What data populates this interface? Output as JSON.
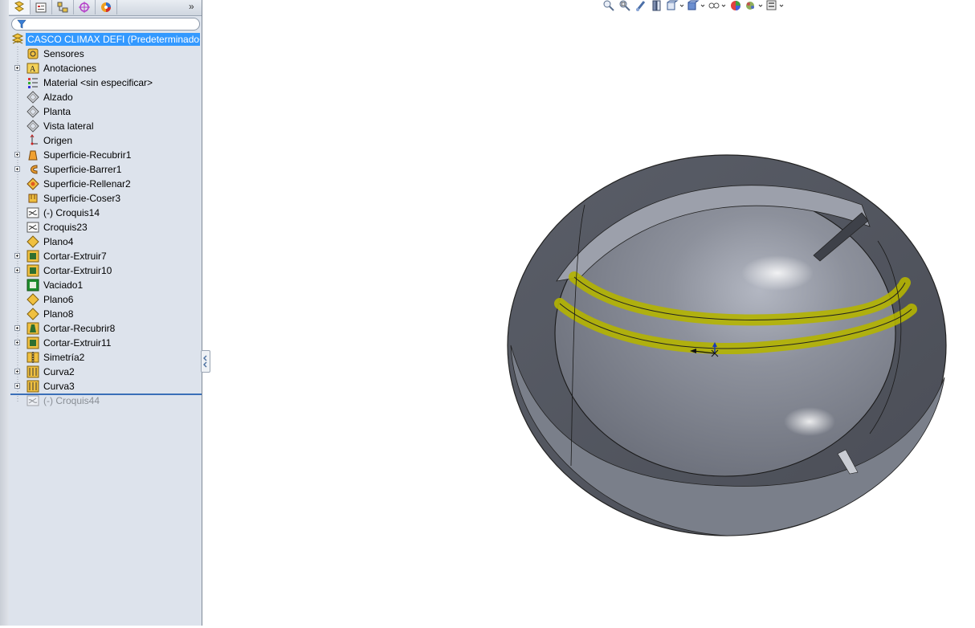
{
  "feature_tree": {
    "root_label": "CASCO CLIMAX DEFI  (Predeterminado<",
    "items": [
      {
        "label": "Sensores",
        "icon": "sensors-icon",
        "expandable": false
      },
      {
        "label": "Anotaciones",
        "icon": "annotations-icon",
        "expandable": true
      },
      {
        "label": "Material <sin especificar>",
        "icon": "material-icon",
        "expandable": false
      },
      {
        "label": "Alzado",
        "icon": "plane-icon",
        "expandable": false
      },
      {
        "label": "Planta",
        "icon": "plane-icon",
        "expandable": false
      },
      {
        "label": "Vista lateral",
        "icon": "plane-icon",
        "expandable": false
      },
      {
        "label": "Origen",
        "icon": "origin-icon",
        "expandable": false
      },
      {
        "label": "Superficie-Recubrir1",
        "icon": "surface-loft-icon",
        "expandable": true
      },
      {
        "label": "Superficie-Barrer1",
        "icon": "surface-sweep-icon",
        "expandable": true
      },
      {
        "label": "Superficie-Rellenar2",
        "icon": "surface-fill-icon",
        "expandable": false
      },
      {
        "label": "Superficie-Coser3",
        "icon": "surface-knit-icon",
        "expandable": false
      },
      {
        "label": "(-) Croquis14",
        "icon": "sketch-icon",
        "expandable": false
      },
      {
        "label": "Croquis23",
        "icon": "sketch-icon",
        "expandable": false
      },
      {
        "label": "Plano4",
        "icon": "ref-plane-icon",
        "expandable": false
      },
      {
        "label": "Cortar-Extruir7",
        "icon": "cut-extrude-icon",
        "expandable": true
      },
      {
        "label": "Cortar-Extruir10",
        "icon": "cut-extrude-icon",
        "expandable": true
      },
      {
        "label": "Vaciado1",
        "icon": "shell-icon",
        "expandable": false
      },
      {
        "label": "Plano6",
        "icon": "ref-plane-icon",
        "expandable": false
      },
      {
        "label": "Plano8",
        "icon": "ref-plane-icon",
        "expandable": false
      },
      {
        "label": "Cortar-Recubrir8",
        "icon": "cut-loft-icon",
        "expandable": true
      },
      {
        "label": "Cortar-Extruir11",
        "icon": "cut-extrude-icon",
        "expandable": true
      },
      {
        "label": "Simetría2",
        "icon": "mirror-icon",
        "expandable": false
      },
      {
        "label": "Curva2",
        "icon": "curve-icon",
        "expandable": true
      },
      {
        "label": "Curva3",
        "icon": "curve-icon",
        "expandable": true
      },
      {
        "label": "(-) Croquis44",
        "icon": "sketch-icon",
        "expandable": false,
        "suppressed": true
      }
    ]
  },
  "panel_tabs": [
    "feature-manager-icon",
    "property-manager-icon",
    "configuration-manager-icon",
    "dimxpert-icon",
    "display-manager-icon"
  ],
  "hud_toolbar": [
    "zoom-to-fit-icon",
    "zoom-to-area-icon",
    "previous-view-icon",
    "section-view-icon",
    "view-orientation-icon",
    "display-style-icon",
    "hide-show-items-icon",
    "edit-appearance-icon",
    "apply-scene-icon",
    "view-settings-icon"
  ],
  "colors": {
    "selection": "#3399ff",
    "panel_bg": "#dde3ec",
    "model_gray": "#6b707b",
    "highlight": "#b8b800"
  }
}
